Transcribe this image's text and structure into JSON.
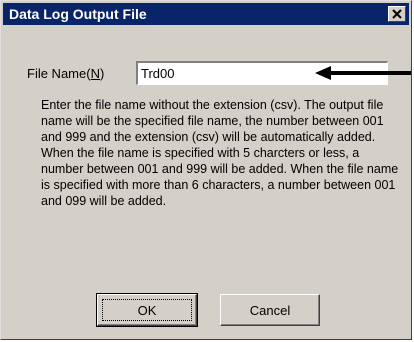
{
  "dialog": {
    "title": "Data Log Output File",
    "close_icon": "close-icon"
  },
  "filename": {
    "label_prefix": "File Name(",
    "label_accel": "N",
    "label_suffix": ")",
    "value": "Trd00"
  },
  "annotation": {
    "icon": "left-arrow-icon"
  },
  "description": {
    "paragraph1": "Enter the file name without the extension (csv). The output file name will be the specified file name, the number between 001 and 999  and the extension (csv) will be automatically added.",
    "paragraph2": "When the file name is specified with 5 charcters or less, a number between 001 and 999 will be added. When the file name is specified with more than 6 characters, a number between 001 and 099 will be added."
  },
  "buttons": {
    "ok": "OK",
    "cancel": "Cancel"
  },
  "colors": {
    "titlebar": "#0a246a",
    "dialog_face": "#d4d0c8"
  }
}
